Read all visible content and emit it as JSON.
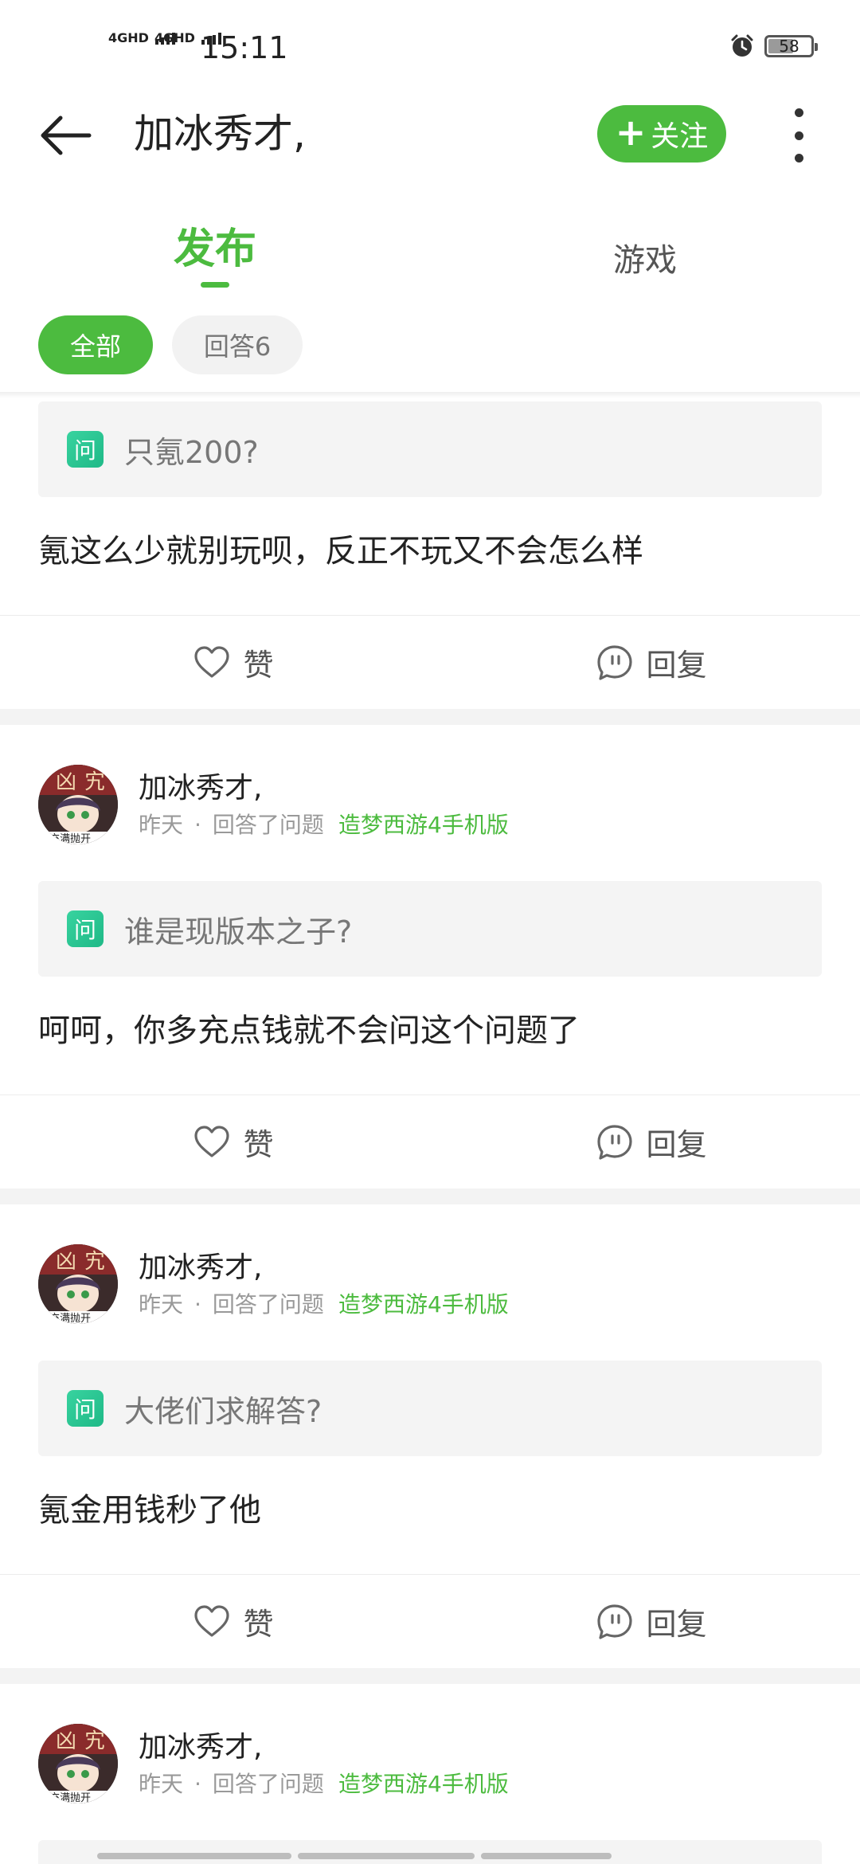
{
  "status_bar": {
    "net1": "4GHD",
    "net2": "4GHD",
    "time": "15:11",
    "battery": "58"
  },
  "header": {
    "title": "加冰秀才,",
    "follow_label": "关注"
  },
  "tabs": [
    {
      "label": "发布",
      "active": true
    },
    {
      "label": "游戏",
      "active": false
    }
  ],
  "filters": [
    {
      "label": "全部",
      "active": true
    },
    {
      "label": "回答6",
      "active": false
    }
  ],
  "colors": {
    "accent": "#4cbb3f",
    "question_badge": "#2ec893",
    "divider": "#f3f3f3"
  },
  "actions": {
    "like": "赞",
    "reply": "回复"
  },
  "cards": [
    {
      "question_badge": "问",
      "question": "只氪200?",
      "answer": "氪这么少就别玩呗，反正不玩又不会怎么样"
    },
    {
      "author": "加冰秀才,",
      "time": "昨天",
      "dot": "·",
      "action": "回答了问题",
      "game": "造梦西游4手机版",
      "question_badge": "问",
      "question": "谁是现版本之子?",
      "answer": "呵呵，你多充点钱就不会问这个问题了"
    },
    {
      "author": "加冰秀才,",
      "time": "昨天",
      "dot": "·",
      "action": "回答了问题",
      "game": "造梦西游4手机版",
      "question_badge": "问",
      "question": "大佬们求解答?",
      "answer": "氪金用钱秒了他"
    },
    {
      "author": "加冰秀才,",
      "time": "昨天",
      "dot": "·",
      "action": "回答了问题",
      "game": "造梦西游4手机版"
    }
  ]
}
